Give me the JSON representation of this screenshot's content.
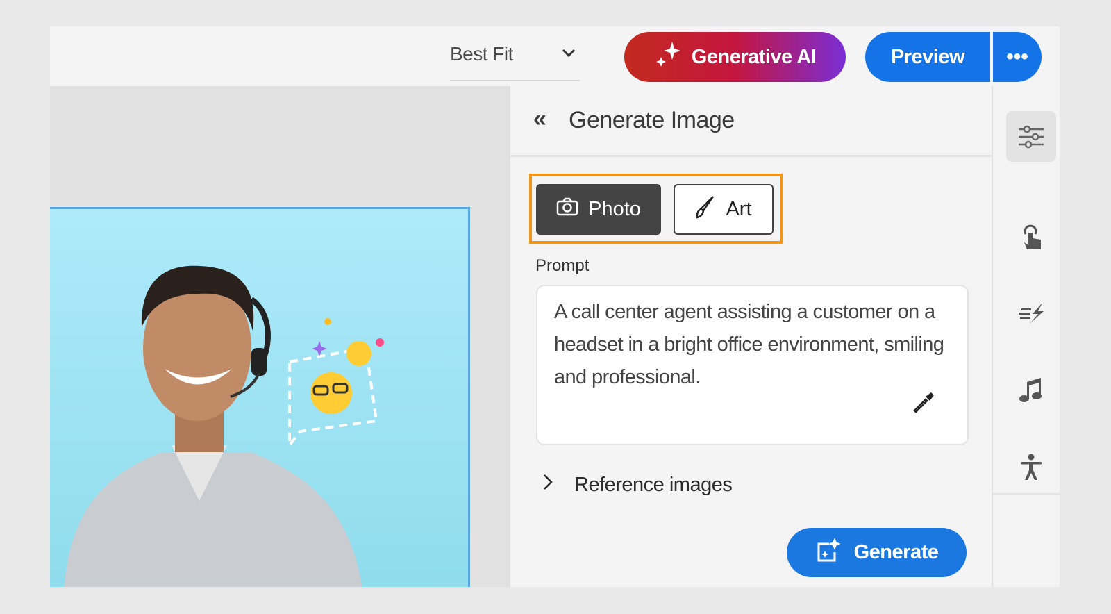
{
  "toolbar": {
    "zoom_value": "Best Fit",
    "generative_ai_label": "Generative AI",
    "preview_label": "Preview",
    "more_label": "•••"
  },
  "panel": {
    "title": "Generate Image",
    "back_icon": "double-chevron-left-icon",
    "modes": [
      {
        "label": "Photo",
        "icon": "camera-icon",
        "selected": true
      },
      {
        "label": "Art",
        "icon": "brush-icon",
        "selected": false
      }
    ],
    "prompt_label": "Prompt",
    "prompt_value": "A call center agent assisting a customer on a headset in a bright office environment, smiling and professional.",
    "reference_images_label": "Reference images",
    "generate_label": "Generate"
  },
  "rail": {
    "icons": [
      "sliders-icon",
      "touch-icon",
      "quick-action-icon",
      "music-icon",
      "accessibility-icon"
    ]
  },
  "colors": {
    "accent": "#1473e6",
    "highlight": "#f0951e",
    "selected_mode": "#444444"
  }
}
